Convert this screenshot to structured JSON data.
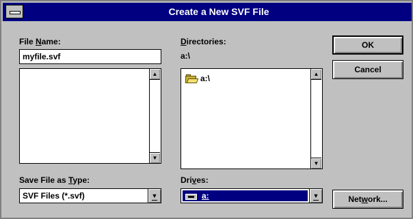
{
  "window": {
    "title": "Create a New SVF File"
  },
  "file_name": {
    "label_pre": "File ",
    "label_key": "N",
    "label_post": "ame:",
    "value": "myfile.svf"
  },
  "directories": {
    "label_key": "D",
    "label_post": "irectories:",
    "current_path": "a:\\",
    "items": [
      {
        "name": "a:\\",
        "icon": "open-folder-icon"
      }
    ]
  },
  "save_type": {
    "label_pre": "Save File as ",
    "label_key": "T",
    "label_post": "ype:",
    "value": "SVF Files (*.svf)"
  },
  "drives": {
    "label_pre": "Dri",
    "label_key": "v",
    "label_post": "es:",
    "value": "a:",
    "icon": "floppy-drive-icon"
  },
  "buttons": {
    "ok": "OK",
    "cancel": "Cancel",
    "network_pre": "Net",
    "network_key": "w",
    "network_post": "ork..."
  }
}
